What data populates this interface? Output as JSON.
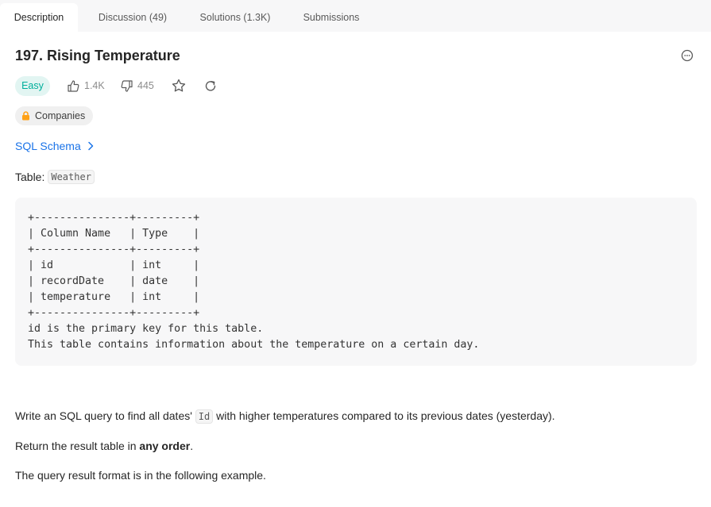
{
  "tabs": [
    {
      "label": "Description",
      "active": true
    },
    {
      "label": "Discussion (49)",
      "active": false
    },
    {
      "label": "Solutions (1.3K)",
      "active": false
    },
    {
      "label": "Submissions",
      "active": false
    }
  ],
  "problem": {
    "title": "197. Rising Temperature",
    "difficulty": "Easy",
    "likes": "1.4K",
    "dislikes": "445",
    "companies_label": "Companies",
    "schema_link": "SQL Schema",
    "table_prefix": "Table:",
    "table_name": "Weather"
  },
  "code_block": "+---------------+---------+\n| Column Name   | Type    |\n+---------------+---------+\n| id            | int     |\n| recordDate    | date    |\n| temperature   | int     |\n+---------------+---------+\nid is the primary key for this table.\nThis table contains information about the temperature on a certain day.",
  "description": {
    "p1_before": "Write an SQL query to find all dates'",
    "p1_code": "Id",
    "p1_after": "with higher temperatures compared to its previous dates (yesterday).",
    "p2_before": "Return the result table in",
    "p2_bold": "any order",
    "p2_after": ".",
    "p3": "The query result format is in the following example."
  },
  "colors": {
    "easy_text": "#00af9b",
    "easy_bg": "#e2f5f2",
    "link": "#1a73e8",
    "lock": "#ffa116"
  },
  "icons": [
    "more-icon",
    "thumbs-up-icon",
    "thumbs-down-icon",
    "star-icon",
    "share-icon",
    "lock-icon",
    "chevron-right-icon"
  ]
}
